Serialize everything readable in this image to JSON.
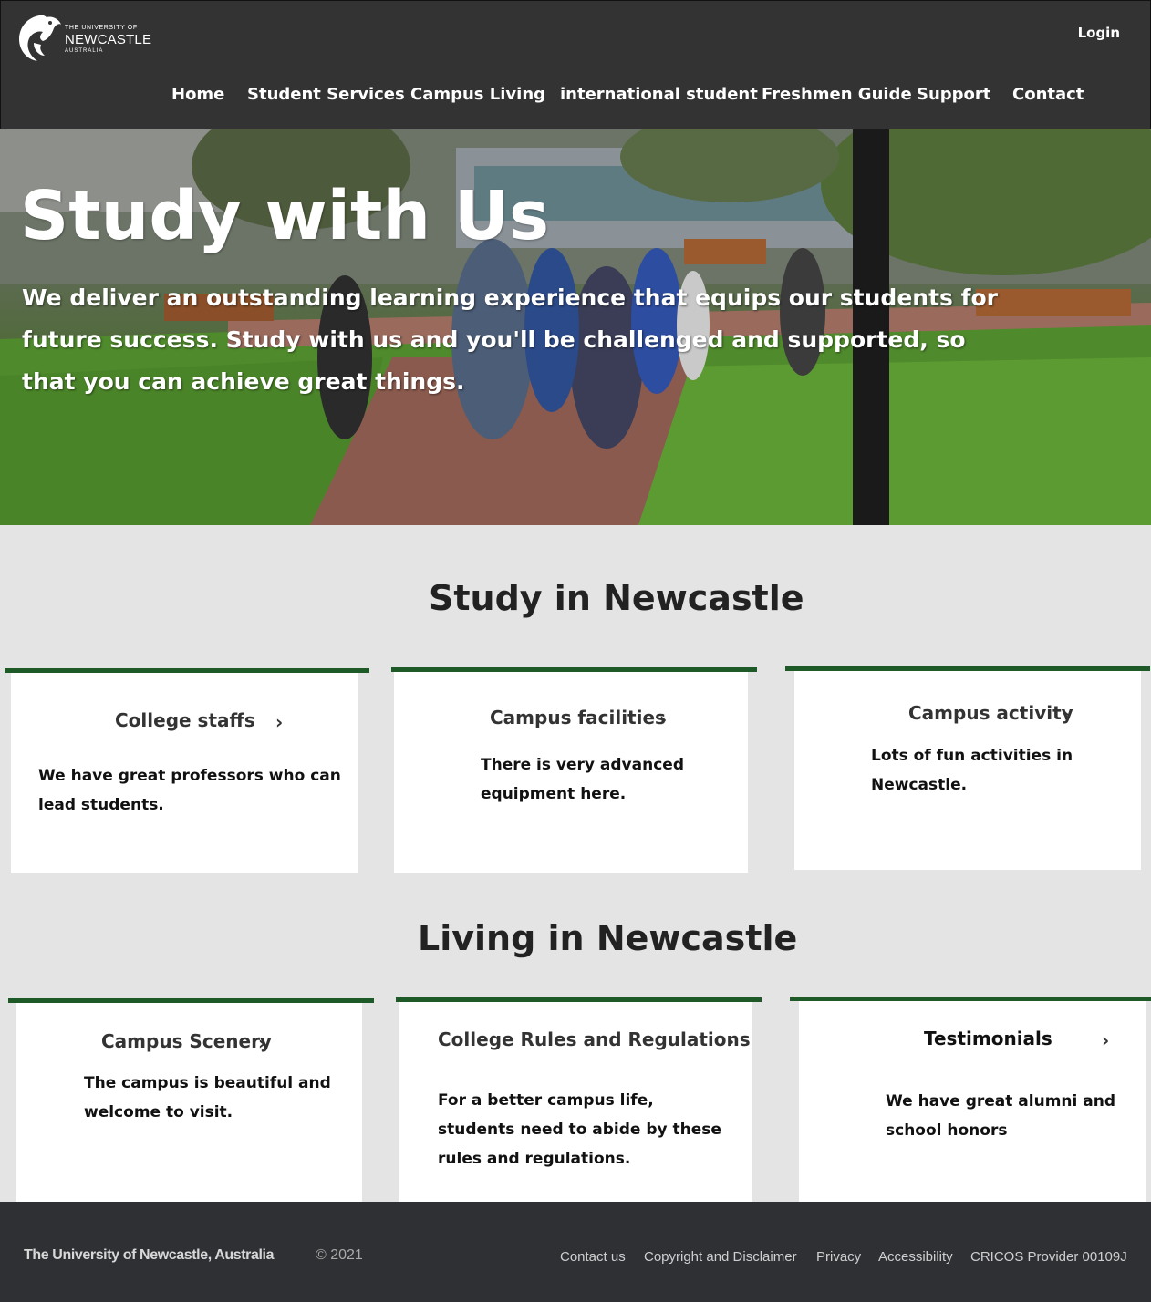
{
  "header": {
    "logo": {
      "line1": "THE UNIVERSITY OF",
      "line2": "NEWCASTLE",
      "line3": "AUSTRALIA"
    },
    "login_label": "Login",
    "nav": [
      {
        "label": "Home"
      },
      {
        "label": "Student Services"
      },
      {
        "label": "Campus Living"
      },
      {
        "label": "international student"
      },
      {
        "label": "Freshmen Guide"
      },
      {
        "label": "Support"
      },
      {
        "label": "Contact"
      }
    ]
  },
  "hero": {
    "title": "Study with Us",
    "text": "We deliver an outstanding learning experience that equips our students for future success. Study with us and you'll be challenged and supported, so that you can achieve great things."
  },
  "study": {
    "title": "Study in Newcastle",
    "cards": [
      {
        "title": "College  staffs",
        "text": "We have great professors who can lead students."
      },
      {
        "title": "Campus facilities",
        "text": "There is very advanced equipment here."
      },
      {
        "title": "Campus activity",
        "text": "Lots of fun activities in Newcastle."
      }
    ]
  },
  "living": {
    "title": "Living in Newcastle",
    "cards": [
      {
        "title": "Campus Scenery",
        "text": "The campus is beautiful and welcome to visit."
      },
      {
        "title": "College Rules and Regulations",
        "text": "For a better campus life, students need to abide by these rules and regulations."
      },
      {
        "title": "Testimonials",
        "text": "We have great alumni and school honors"
      }
    ]
  },
  "footer": {
    "name": "The University of Newcastle, Australia",
    "copyright": "© 2021",
    "links": [
      {
        "label": "Contact us"
      },
      {
        "label": "Copyright and Disclaimer"
      },
      {
        "label": "Privacy"
      },
      {
        "label": "Accessibility"
      },
      {
        "label": "CRICOS Provider 00109J"
      }
    ]
  },
  "colors": {
    "header_bg": "#333333",
    "accent_green": "#1e5a28",
    "page_bg": "#e4e4e4",
    "footer_bg": "#2e3033"
  }
}
